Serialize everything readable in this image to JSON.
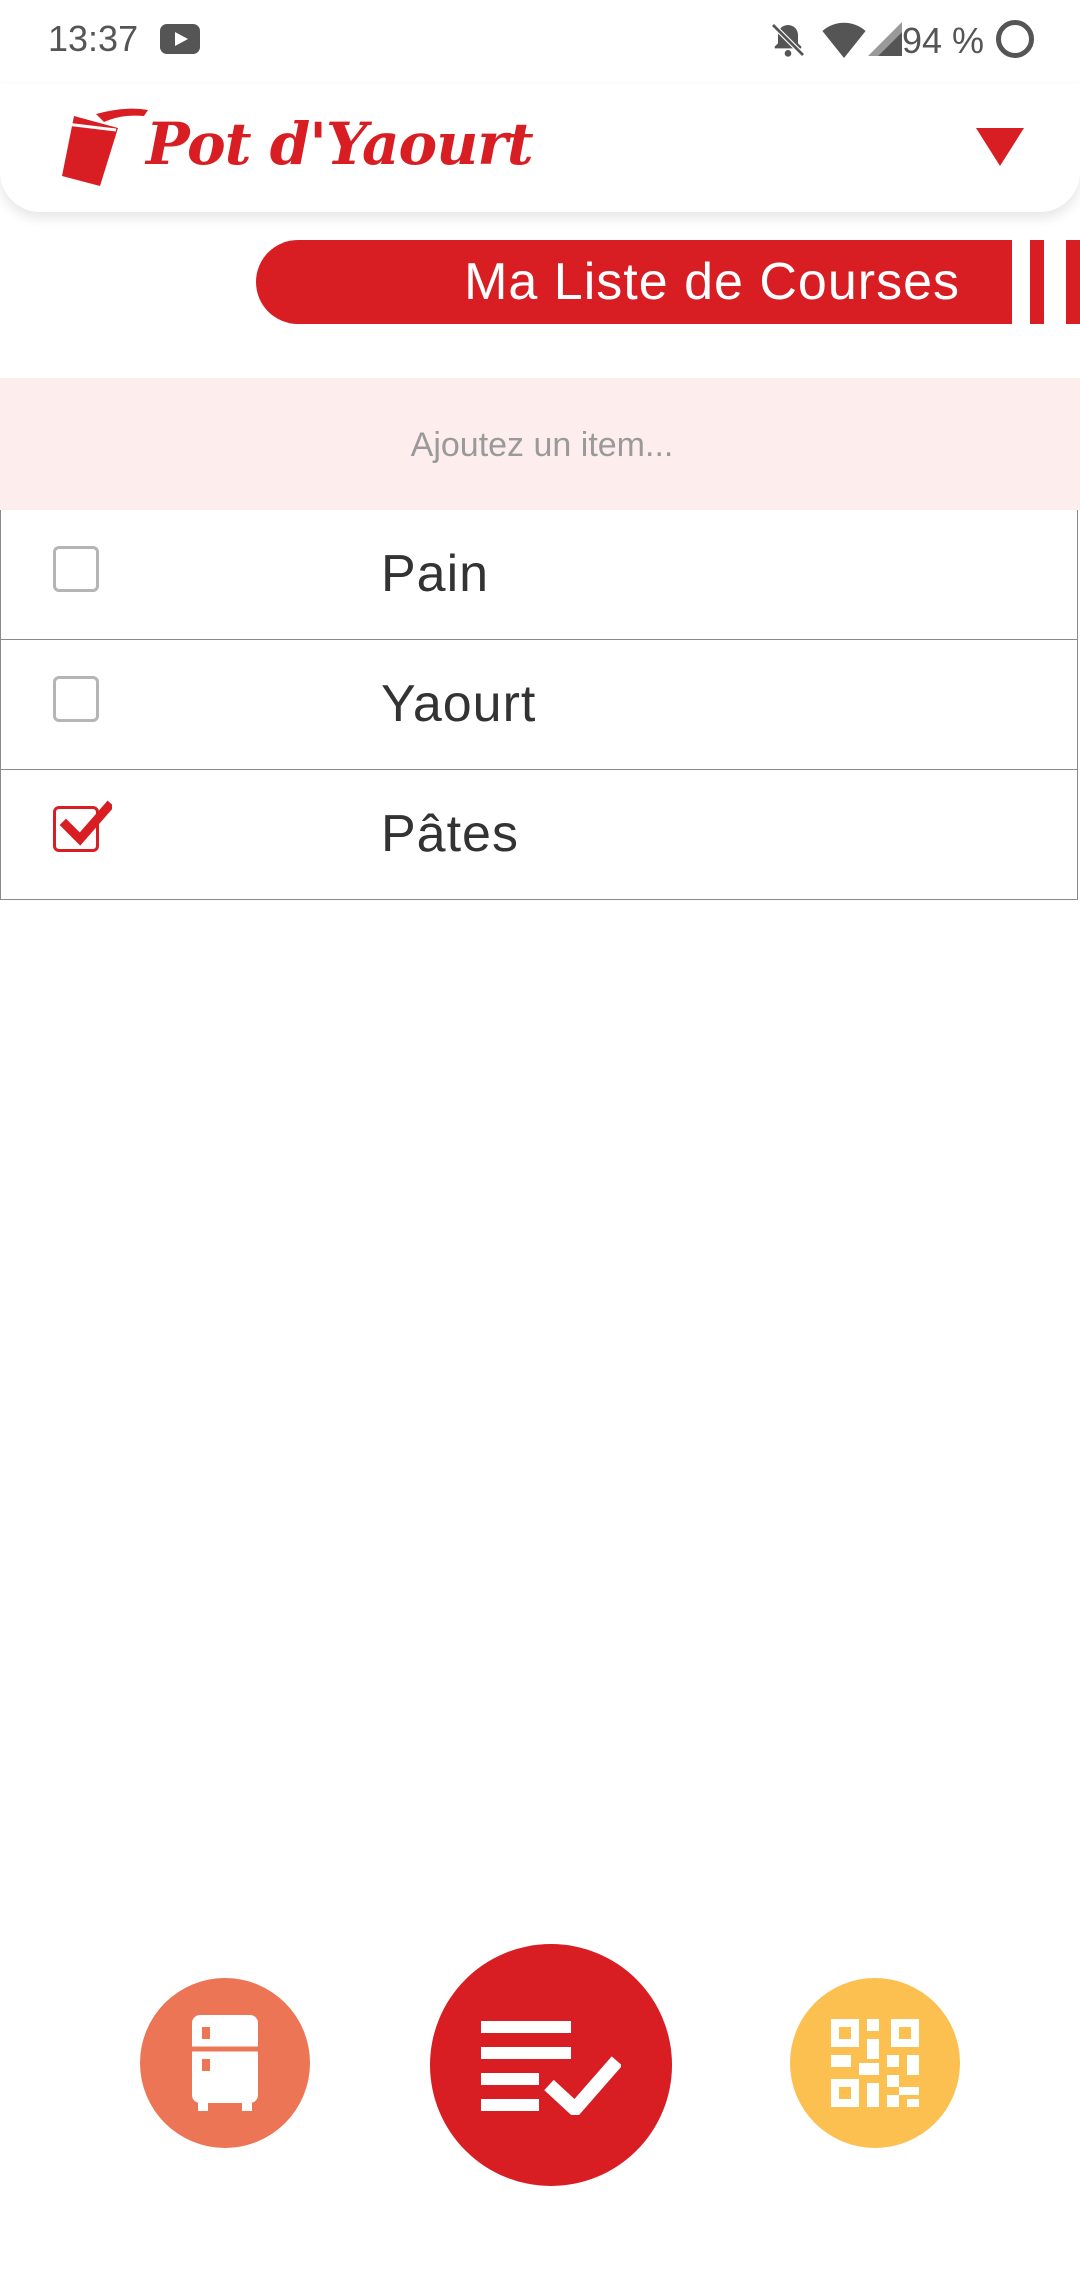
{
  "status_bar": {
    "time": "13:37",
    "battery_text": "94 %",
    "icons": [
      "youtube-icon",
      "bell-off-icon",
      "wifi-icon",
      "signal-icon",
      "battery-ring-icon"
    ]
  },
  "header": {
    "app_name": "Pot d'Yaourt",
    "logo_icon": "yogurt-pot-icon",
    "menu_icon": "triangle-down-icon"
  },
  "page": {
    "title": "Ma Liste de Courses"
  },
  "add_item": {
    "placeholder": "Ajoutez un item..."
  },
  "items": [
    {
      "label": "Pain",
      "checked": false
    },
    {
      "label": "Yaourt",
      "checked": false
    },
    {
      "label": "Pâtes",
      "checked": true
    }
  ],
  "bottom_nav": [
    {
      "name": "fridge",
      "icon": "fridge-icon",
      "color": "#ec7556"
    },
    {
      "name": "shopping-list",
      "icon": "checklist-icon",
      "color": "#d81e23"
    },
    {
      "name": "qr-code",
      "icon": "qr-code-icon",
      "color": "#fbc04f"
    }
  ],
  "colors": {
    "accent": "#d81e23",
    "input_background": "#fdeeed"
  }
}
